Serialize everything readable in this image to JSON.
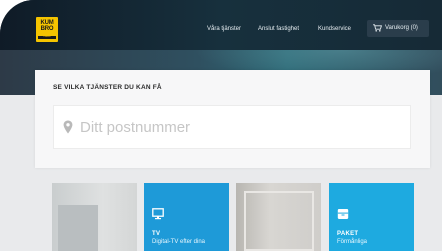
{
  "header": {
    "logo": {
      "line1": "KUM",
      "line2": "BRO",
      "tagline": "Kumbro"
    },
    "nav": [
      {
        "label": "Våra tjänster"
      },
      {
        "label": "Anslut fastighet"
      },
      {
        "label": "Kundservice"
      }
    ],
    "cart": {
      "label": "Varukorg (0)",
      "icon": "cart-icon"
    }
  },
  "search_panel": {
    "title": "SE VILKA TJÄNSTER DU KAN FÅ",
    "postal": {
      "placeholder": "Ditt postnummer",
      "icon": "map-pin-icon"
    }
  },
  "cards": [
    {
      "kind": "photo"
    },
    {
      "kind": "service",
      "title": "TV",
      "subtitle": "Digital-TV efter dina",
      "icon": "monitor-icon",
      "color": "#1e9ad8"
    },
    {
      "kind": "photo"
    },
    {
      "kind": "service",
      "title": "PAKET",
      "subtitle": "Förmånliga",
      "icon": "package-icon",
      "color": "#1eaae0"
    }
  ],
  "colors": {
    "brand_yellow": "#f5c400",
    "nav_dark": "#0f1b27",
    "accent_blue": "#1e9ad8"
  }
}
